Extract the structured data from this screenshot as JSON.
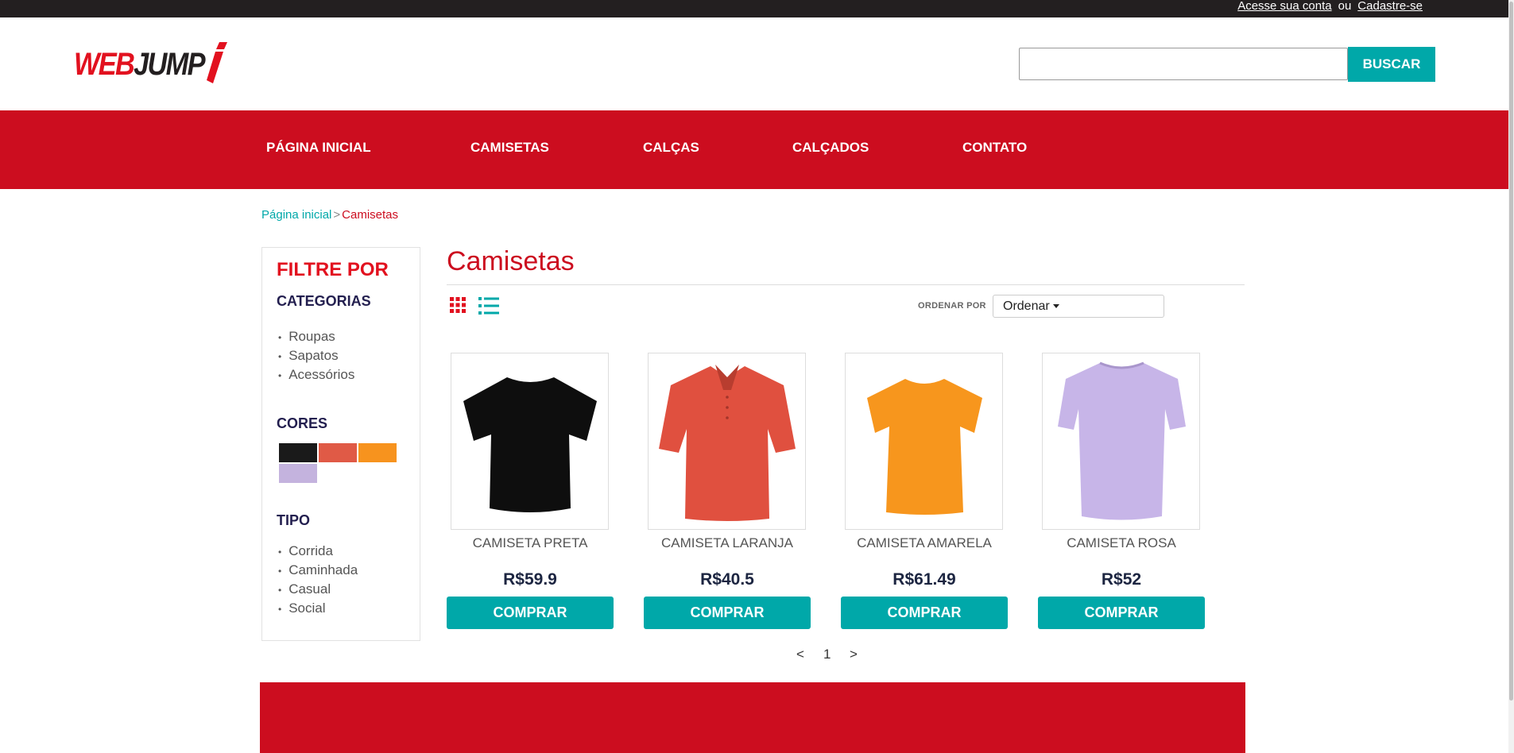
{
  "topbar": {
    "login_link": "Acesse sua conta",
    "separator": "ou",
    "signup_link": "Cadastre-se"
  },
  "brand": {
    "logo_text_red": "WEB",
    "logo_text_dark": "JUMP",
    "logo_mark": "i"
  },
  "search": {
    "value": "",
    "placeholder": "",
    "button_label": "BUSCAR"
  },
  "nav": {
    "items": [
      "PÁGINA INICIAL",
      "CAMISETAS",
      "CALÇAS",
      "CALÇADOS",
      "CONTATO"
    ]
  },
  "breadcrumb": {
    "home": "Página inicial",
    "separator": ">",
    "current": "Camisetas"
  },
  "sidebar": {
    "title": "FILTRE POR",
    "categories_title": "CATEGORIAS",
    "categories": [
      "Roupas",
      "Sapatos",
      "Acessórios"
    ],
    "colors_title": "CORES",
    "colors": [
      "#1a1a1a",
      "#e05a46",
      "#f7931e",
      "#c4b3de"
    ],
    "type_title": "TIPO",
    "types": [
      "Corrida",
      "Caminhada",
      "Casual",
      "Social"
    ]
  },
  "main": {
    "title": "Camisetas",
    "view_icons": [
      "grid-icon",
      "list-icon"
    ],
    "sort_label": "ORDENAR POR",
    "sort_value": "Ordenar"
  },
  "products": [
    {
      "name": "CAMISETA PRETA",
      "price": "R$59.9",
      "button": "COMPRAR",
      "color": "#0e0e0e",
      "style": "tshirt"
    },
    {
      "name": "CAMISETA LARANJA",
      "price": "R$40.5",
      "button": "COMPRAR",
      "color": "#e0503f",
      "style": "polo"
    },
    {
      "name": "CAMISETA AMARELA",
      "price": "R$61.49",
      "button": "COMPRAR",
      "color": "#f7961d",
      "style": "tshirt"
    },
    {
      "name": "CAMISETA ROSA",
      "price": "R$52",
      "button": "COMPRAR",
      "color": "#c7b5e8",
      "style": "tshirt"
    }
  ],
  "pagination": {
    "prev": "<",
    "current": "1",
    "next": ">"
  },
  "colors": {
    "brand_red": "#cc0d1f",
    "accent_teal": "#00a8a9",
    "topbar": "#231f20"
  }
}
